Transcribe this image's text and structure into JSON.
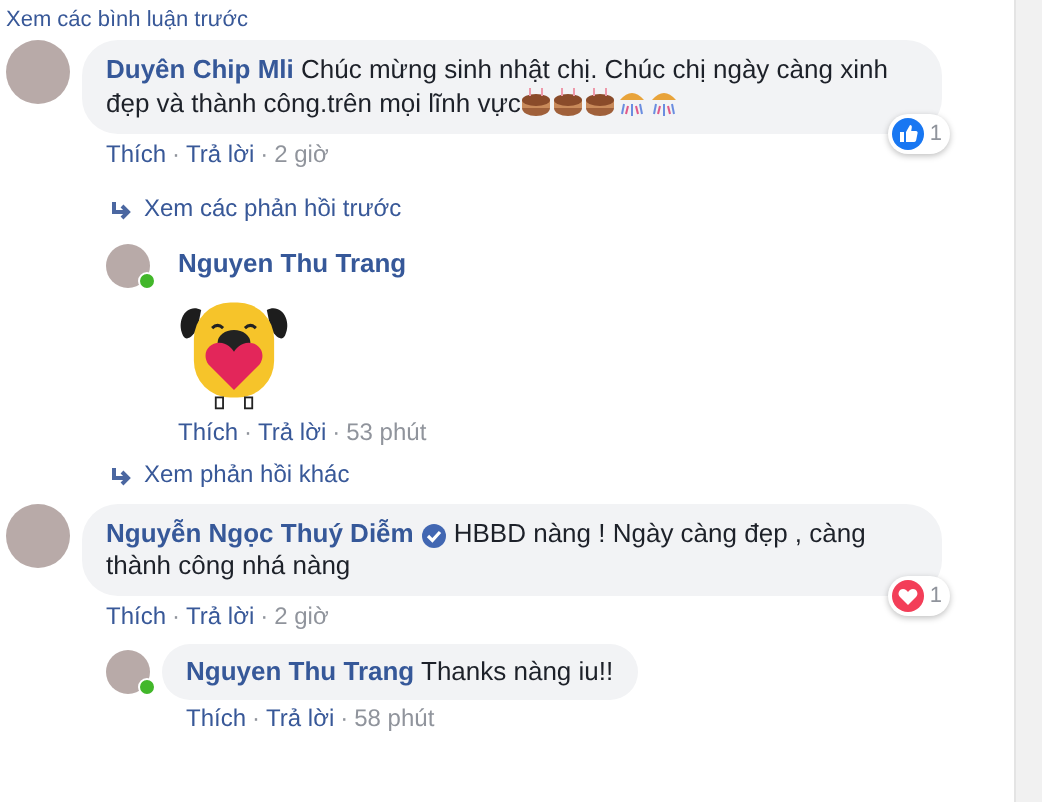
{
  "top_link": "Xem các bình luận trước",
  "separator": "·",
  "comments": [
    {
      "name": "Duyên Chip Mli",
      "verified": false,
      "text": "Chúc mừng sinh nhật chị. Chúc chị ngày càng xinh đẹp và thành công.trên mọi lĩnh vực",
      "emoji": [
        {
          "kind": "cake"
        },
        {
          "kind": "cake"
        },
        {
          "kind": "cake"
        },
        {
          "kind": "fireworks"
        },
        {
          "kind": "fireworks"
        }
      ],
      "reaction": {
        "kind": "like",
        "count": "1"
      },
      "actions": [
        "Thích",
        "Trả lời"
      ],
      "time": "2 giờ",
      "thread": [
        {
          "kind": "link",
          "text": "Xem các phản hồi trước"
        },
        {
          "kind": "sticker_reply",
          "name": "Nguyen Thu Trang",
          "online": true,
          "actions": [
            "Thích",
            "Trả lời"
          ],
          "time": "53 phút"
        },
        {
          "kind": "link",
          "text": "Xem phản hồi khác"
        }
      ]
    },
    {
      "name": "Nguyễn Ngọc Thuý Diễm",
      "verified": true,
      "text": "HBBD nàng ! Ngày càng đẹp , càng thành công nhá nàng",
      "reaction": {
        "kind": "love",
        "count": "1"
      },
      "actions": [
        "Thích",
        "Trả lời"
      ],
      "time": "2 giờ",
      "thread": [
        {
          "kind": "text_reply",
          "name": "Nguyen Thu Trang",
          "online": true,
          "text": "Thanks nàng iu!!",
          "actions": [
            "Thích",
            "Trả lời"
          ],
          "time": "58 phút"
        }
      ]
    }
  ]
}
